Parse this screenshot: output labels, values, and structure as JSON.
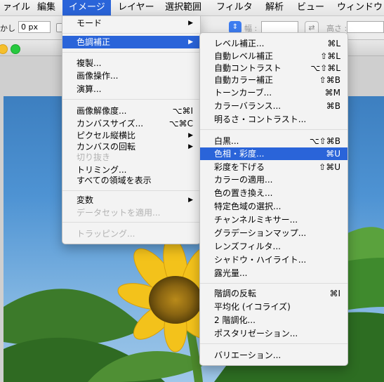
{
  "menubar": {
    "items": [
      {
        "label": "ァイル"
      },
      {
        "label": "編集"
      },
      {
        "label": "イメージ"
      },
      {
        "label": "レイヤー"
      },
      {
        "label": "選択範囲"
      },
      {
        "label": "フィルタ"
      },
      {
        "label": "解析"
      },
      {
        "label": "ビュー"
      },
      {
        "label": "ウィンドウ"
      }
    ],
    "active": "イメージ"
  },
  "options_bar": {
    "feather_label": "かし :",
    "feather_value": "0 px",
    "width_label": "幅 :",
    "height_label": "高さ :"
  },
  "image_menu": {
    "items": [
      {
        "label": "モード",
        "shortcut": "",
        "submenu": true,
        "disabled": false
      },
      {
        "label": "色調補正",
        "shortcut": "",
        "submenu": true,
        "disabled": false,
        "highlighted": true
      },
      {
        "label": "複製...",
        "shortcut": "",
        "submenu": false,
        "disabled": false
      },
      {
        "label": "画像操作...",
        "shortcut": "",
        "submenu": false,
        "disabled": false
      },
      {
        "label": "演算...",
        "shortcut": "",
        "submenu": false,
        "disabled": false
      },
      {
        "label": "画像解像度...",
        "shortcut": "⌥⌘I",
        "submenu": false,
        "disabled": false
      },
      {
        "label": "カンバスサイズ...",
        "shortcut": "⌥⌘C",
        "submenu": false,
        "disabled": false
      },
      {
        "label": "ピクセル縦横比",
        "shortcut": "",
        "submenu": true,
        "disabled": false
      },
      {
        "label": "カンバスの回転",
        "shortcut": "",
        "submenu": true,
        "disabled": false
      },
      {
        "label": "切り抜き",
        "shortcut": "",
        "submenu": false,
        "disabled": true
      },
      {
        "label": "トリミング...",
        "shortcut": "",
        "submenu": false,
        "disabled": false
      },
      {
        "label": "すべての領域を表示",
        "shortcut": "",
        "submenu": false,
        "disabled": false
      },
      {
        "label": "変数",
        "shortcut": "",
        "submenu": true,
        "disabled": false
      },
      {
        "label": "データセットを適用...",
        "shortcut": "",
        "submenu": false,
        "disabled": true
      },
      {
        "label": "トラッピング...",
        "shortcut": "",
        "submenu": false,
        "disabled": true
      }
    ]
  },
  "adjust_menu": {
    "items": [
      {
        "label": "レベル補正...",
        "shortcut": "⌘L"
      },
      {
        "label": "自動レベル補正",
        "shortcut": "⇧⌘L"
      },
      {
        "label": "自動コントラスト",
        "shortcut": "⌥⇧⌘L"
      },
      {
        "label": "自動カラー補正",
        "shortcut": "⇧⌘B"
      },
      {
        "label": "トーンカーブ...",
        "shortcut": "⌘M"
      },
      {
        "label": "カラーバランス...",
        "shortcut": "⌘B"
      },
      {
        "label": "明るさ・コントラスト...",
        "shortcut": ""
      },
      {
        "label": "白黒...",
        "shortcut": "⌥⇧⌘B"
      },
      {
        "label": "色相・彩度...",
        "shortcut": "⌘U",
        "highlighted": true
      },
      {
        "label": "彩度を下げる",
        "shortcut": "⇧⌘U"
      },
      {
        "label": "カラーの適用...",
        "shortcut": ""
      },
      {
        "label": "色の置き換え...",
        "shortcut": ""
      },
      {
        "label": "特定色域の選択...",
        "shortcut": ""
      },
      {
        "label": "チャンネルミキサー...",
        "shortcut": ""
      },
      {
        "label": "グラデーションマップ...",
        "shortcut": ""
      },
      {
        "label": "レンズフィルタ...",
        "shortcut": ""
      },
      {
        "label": "シャドウ・ハイライト...",
        "shortcut": ""
      },
      {
        "label": "露光量...",
        "shortcut": ""
      },
      {
        "label": "階調の反転",
        "shortcut": "⌘I"
      },
      {
        "label": "平均化 (イコライズ)",
        "shortcut": ""
      },
      {
        "label": "2 階調化...",
        "shortcut": ""
      },
      {
        "label": "ポスタリゼーション...",
        "shortcut": ""
      },
      {
        "label": "バリエーション...",
        "shortcut": ""
      }
    ]
  },
  "icons": {
    "submenu_arrow": "submenu-arrow-icon",
    "swap": "swap-icon",
    "dropdown": "dropdown-icon"
  },
  "colors": {
    "highlight": "#2a64d9",
    "menu_bg": "#f3f3f3",
    "traffic_yellow": "#f5bf2c",
    "traffic_green": "#27c93f"
  }
}
